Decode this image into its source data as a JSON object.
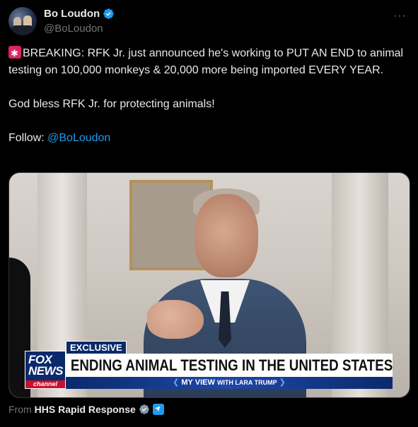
{
  "header": {
    "display_name": "Bo Loudon",
    "handle": "@BoLoudon",
    "more_label": "···"
  },
  "tweet": {
    "line1": "BREAKING: RFK Jr. just announced he's working to PUT AN END to animal testing on 100,000 monkeys & 20,000 more being imported EVERY YEAR.",
    "line2": "God bless RFK Jr. for protecting animals!",
    "follow_prefix": "Follow: ",
    "follow_mention": "@BoLoudon"
  },
  "media": {
    "network_top": "FOX",
    "network_mid": "NEWS",
    "network_bottom": "channel",
    "exclusive_label": "EXCLUSIVE",
    "headline": "ENDING ANIMAL TESTING IN THE UNITED STATES",
    "show_name": "MY VIEW",
    "show_host": "WITH LARA TRUMP"
  },
  "footer": {
    "from_label": "From",
    "source_name": "HHS Rapid Response"
  },
  "colors": {
    "accent": "#1d9bf0",
    "background": "#000000",
    "text": "#e7e9ea",
    "muted": "#71767b"
  },
  "icons": {
    "verified": "verified-badge-icon",
    "siren": "siren-emoji-icon",
    "government": "government-affiliation-icon"
  }
}
